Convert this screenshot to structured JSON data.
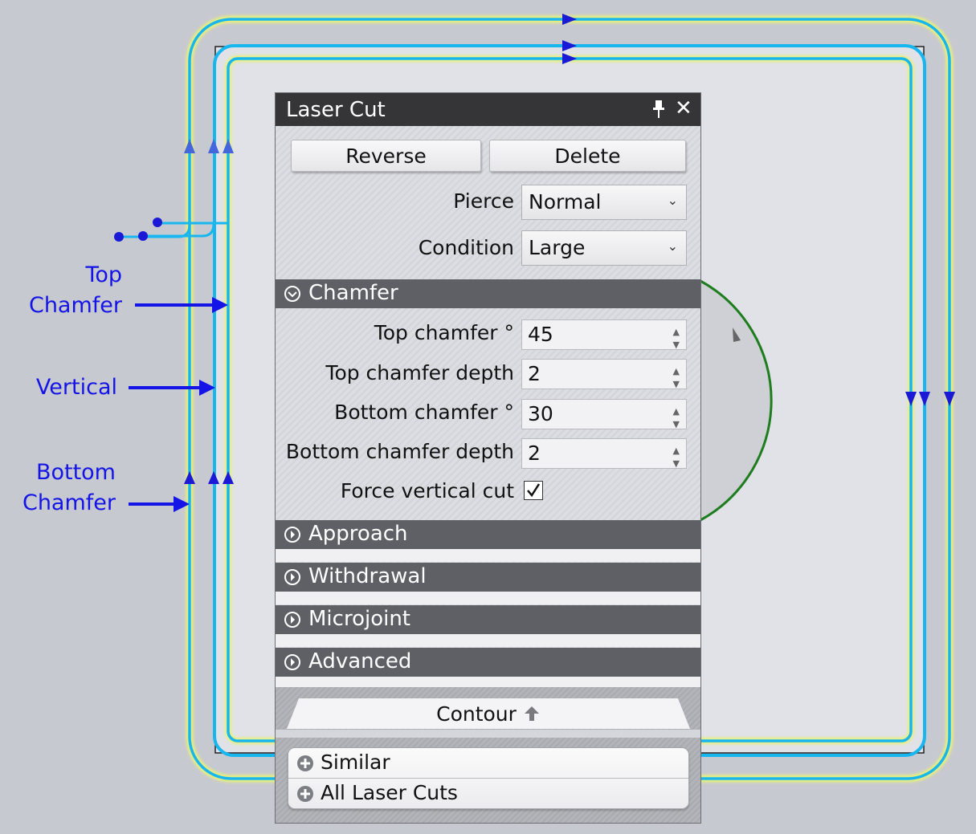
{
  "annotations": {
    "top_chamfer": [
      "Top",
      "Chamfer"
    ],
    "vertical": "Vertical",
    "bottom_chamfer": [
      "Bottom",
      "Chamfer"
    ]
  },
  "panel": {
    "title": "Laser Cut",
    "buttons": {
      "reverse": "Reverse",
      "delete": "Delete"
    },
    "pierce": {
      "label": "Pierce",
      "value": "Normal"
    },
    "condition": {
      "label": "Condition",
      "value": "Large"
    },
    "chamfer": {
      "header": "Chamfer",
      "expanded": true,
      "top_angle": {
        "label": "Top chamfer °",
        "value": "45"
      },
      "top_depth": {
        "label": "Top chamfer depth",
        "value": "2"
      },
      "bottom_angle": {
        "label": "Bottom chamfer °",
        "value": "30"
      },
      "bottom_depth": {
        "label": "Bottom chamfer depth",
        "value": "2"
      },
      "force_vertical": {
        "label": "Force vertical cut",
        "checked": true
      }
    },
    "sections": [
      "Approach",
      "Withdrawal",
      "Microjoint",
      "Advanced"
    ],
    "contour_tab": "Contour",
    "list": [
      "Similar",
      "All Laser Cuts"
    ]
  },
  "colors": {
    "canvas_bg": "#c7c9d0",
    "path_cyan": "#18b6ee",
    "path_glow": "#e8f07a",
    "arrow_blue": "#1a1ad6",
    "annotation_blue": "#1414e6",
    "arc_green": "#1e7d1e",
    "section_header": "#5f6066",
    "titlebar": "#353538"
  }
}
